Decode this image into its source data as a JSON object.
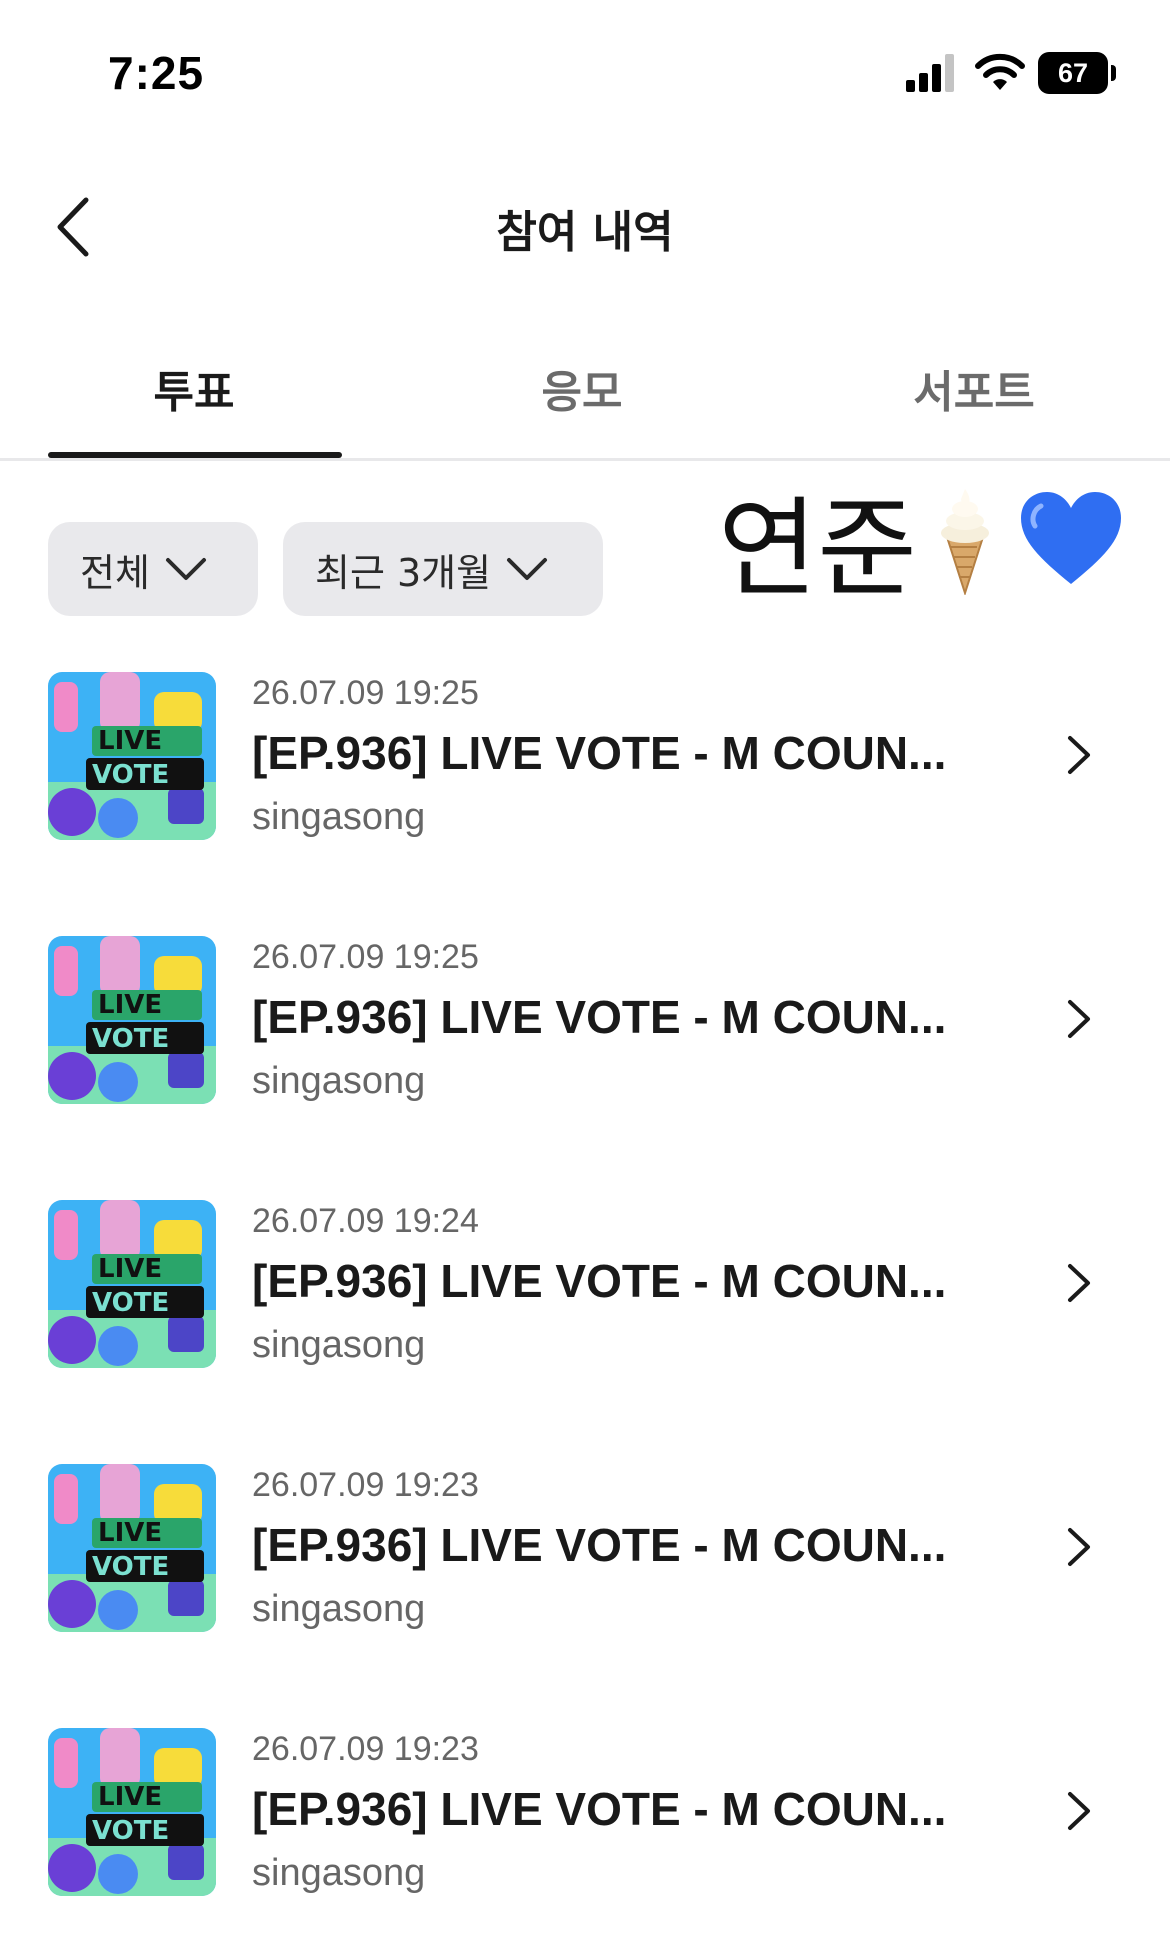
{
  "status_bar": {
    "time": "7:25",
    "battery": "67"
  },
  "header": {
    "title": "참여 내역"
  },
  "tabs": [
    {
      "label": "투표",
      "active": true
    },
    {
      "label": "응모",
      "active": false
    },
    {
      "label": "서포트",
      "active": false
    }
  ],
  "filters": {
    "type": "전체",
    "period": "최근 3개월"
  },
  "sticker": {
    "text": "연준",
    "emoji": [
      "soft-ice-cream-icon",
      "blue-heart-icon"
    ]
  },
  "colors": {
    "accent": "#1a1a1a",
    "chip_bg": "#e9e9ec",
    "muted_text": "#666666",
    "heart": "#2f6ef2"
  },
  "items": [
    {
      "date": "26.07.09 19:25",
      "title": "[EP.936] LIVE VOTE - M COUN...",
      "subtitle": "singasong",
      "thumbnail_text": [
        "LIVE",
        "VOTE"
      ]
    },
    {
      "date": "26.07.09 19:25",
      "title": "[EP.936] LIVE VOTE - M COUN...",
      "subtitle": "singasong",
      "thumbnail_text": [
        "LIVE",
        "VOTE"
      ]
    },
    {
      "date": "26.07.09 19:24",
      "title": "[EP.936] LIVE VOTE - M COUN...",
      "subtitle": "singasong",
      "thumbnail_text": [
        "LIVE",
        "VOTE"
      ]
    },
    {
      "date": "26.07.09 19:23",
      "title": "[EP.936] LIVE VOTE - M COUN...",
      "subtitle": "singasong",
      "thumbnail_text": [
        "LIVE",
        "VOTE"
      ]
    },
    {
      "date": "26.07.09 19:23",
      "title": "[EP.936] LIVE VOTE - M COUN...",
      "subtitle": "singasong",
      "thumbnail_text": [
        "LIVE",
        "VOTE"
      ]
    }
  ]
}
